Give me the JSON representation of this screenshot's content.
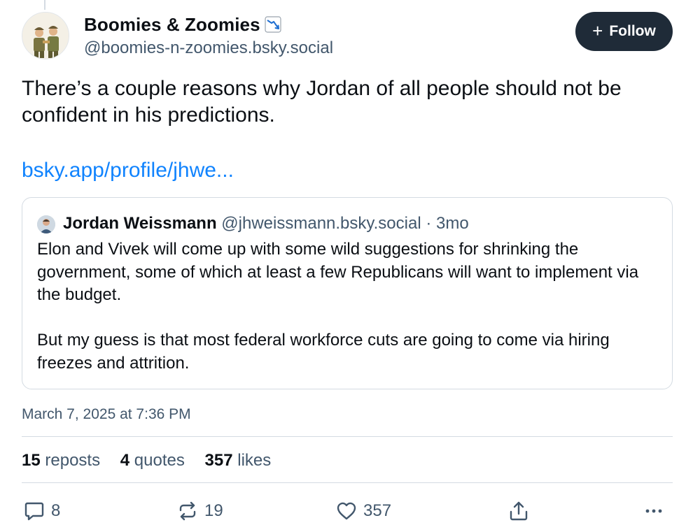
{
  "author": {
    "name": "Boomies & Zoomies",
    "handle": "@boomies-n-zoomies.bsky.social",
    "avatar_icon": "two-figures-avatar-icon",
    "name_emoji": "chart-decreasing-icon"
  },
  "follow_button": {
    "label": "Follow",
    "icon": "plus-icon"
  },
  "post": {
    "text": "There’s a couple reasons why Jordan of all people should not be confident in his predictions.",
    "link": "bsky.app/profile/jhwe..."
  },
  "quote": {
    "author_name": "Jordan Weissmann",
    "handle_time": "@jhweissmann.bsky.social · 3mo",
    "paragraphs": [
      "Elon and Vivek will come up with some wild suggestions for shrinking the government, some of which at least a few Republicans will want to implement via the budget.",
      "But my guess is that most federal workforce cuts are going to come via hiring freezes and attrition."
    ]
  },
  "timestamp": "March 7, 2025 at 7:36 PM",
  "stats": {
    "reposts": {
      "count": "15",
      "label": "reposts"
    },
    "quotes": {
      "count": "4",
      "label": "quotes"
    },
    "likes": {
      "count": "357",
      "label": "likes"
    }
  },
  "actions": {
    "reply": {
      "icon": "reply-bubble-icon",
      "count": "8"
    },
    "repost": {
      "icon": "repost-icon",
      "count": "19"
    },
    "like": {
      "icon": "heart-icon",
      "count": "357"
    },
    "share": {
      "icon": "share-icon"
    },
    "more": {
      "icon": "more-dots-icon"
    }
  },
  "colors": {
    "text": "#0b0f14",
    "secondary": "#42576c",
    "link": "#1083fe",
    "border": "#d4dbe2",
    "follow_bg": "#1f2b38"
  }
}
